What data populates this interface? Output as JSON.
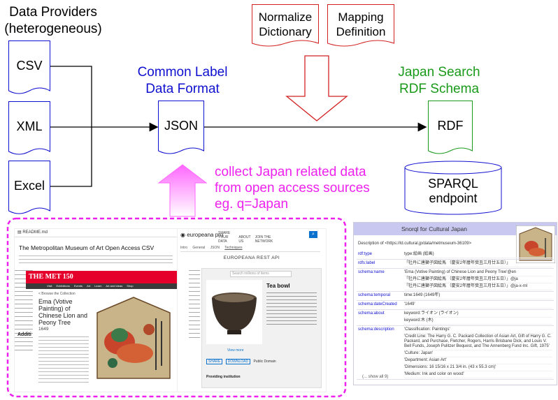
{
  "providers": {
    "title_line1": "Data Providers",
    "title_line2": "(heterogeneous)",
    "csv": "CSV",
    "xml": "XML",
    "excel": "Excel"
  },
  "common_label": {
    "line1": "Common Label",
    "line2": "Data Format"
  },
  "json_label": "JSON",
  "normalize": {
    "line1": "Normalize",
    "line2": "Dictionary"
  },
  "mapping": {
    "line1": "Mapping",
    "line2": "Definition"
  },
  "japan_search": {
    "line1": "Japan Search",
    "line2": "RDF Schema"
  },
  "rdf_label": "RDF",
  "sparql": {
    "line1": "SPARQL",
    "line2": "endpoint"
  },
  "collect": {
    "line1": "collect Japan related data",
    "line2": "from open access sources",
    "line3": "eg. q=Japan"
  },
  "met": {
    "file": "README.md",
    "heading": "The Metropolitan Museum of Art Open Access CSV",
    "logo": "THE MET 150",
    "breadcrumb": "< Browse the Collection",
    "artwork_title": "Ema (Votive Painting) of Chinese Lion and Peony Tree",
    "year": "1649",
    "nav": [
      "Visit",
      "Exhibitions",
      "Events",
      "Art",
      "Learn",
      "Art and Ideas",
      "Shop"
    ],
    "side_heading": "Additi"
  },
  "europeana": {
    "brand": "europeana pro",
    "nav": [
      "SHARE YOUR DATA",
      "ABOUT US",
      "JOIN THE NETWORK"
    ],
    "tabs": [
      "Intro",
      "General",
      "JSON",
      "Techniques"
    ],
    "api_title": "EUROPEANA REST API",
    "item_title": "Tea bowl",
    "search_placeholder": "Search millions of items",
    "view_more": "View more",
    "buttons": [
      "SHARE",
      "DOWNLOAD",
      "Public Domain"
    ],
    "providing": "Providing institution"
  },
  "snorql": {
    "title": "Snorql for Cultural Japan",
    "description": "Description of <https://ld.cultural.jp/data/metmuseum-36109>",
    "rows": [
      {
        "key": "rdf:type",
        "values": [
          "type:絵画 (絵画)"
        ]
      },
      {
        "key": "rdfs:label",
        "values": [
          "「牡丹に唐獅子図絵馬 （慶安2年暦年癸丑三月廿五日）」"
        ]
      },
      {
        "key": "schema:name",
        "values": [
          "'Ema (Votive Painting) of Chinese Lion and Peony Tree'@en",
          "「牡丹に唐獅子図絵馬 （慶安2年暦年癸丑三月廿五日）」@ja",
          "「牡丹に唐獅子図絵馬 （慶安2年暦年癸丑三月廿五日）」@ja-x-ml"
        ]
      },
      {
        "key": "schema:temporal",
        "values": [
          "time:1649 (1649年)"
        ]
      },
      {
        "key": "schema:dateCreated",
        "values": [
          "'1649'"
        ]
      },
      {
        "key": "schema:about",
        "values": [
          "keyword:ライオン (ライオン)",
          "keyword:木 (木)"
        ]
      },
      {
        "key": "schema:description",
        "values": [
          "'Classification: Paintings'",
          "'Credit Line: The Harry G. C. Packard Collection of Asian Art, Gift of Harry G. C. Packard, and Purchase, Fletcher, Rogers, Harris Brisbane Dick, and Louis V. Bell Funds, Joseph Pulitzer Bequest, and The Annenberg Fund Inc. Gift, 1975'",
          "'Culture: Japan'",
          "'Department: Asian Art'",
          "'Dimensions: 16 15/16 x 21 3/4 in. (43 x 55.3 cm)'",
          "'Medium: Ink and color on wood'"
        ]
      }
    ],
    "show_all": "(... show all 9)"
  },
  "colors": {
    "blue": "#1010d0",
    "green": "#1a9a1a",
    "pink": "#ee22ee",
    "arrow_red": "#d22222"
  }
}
